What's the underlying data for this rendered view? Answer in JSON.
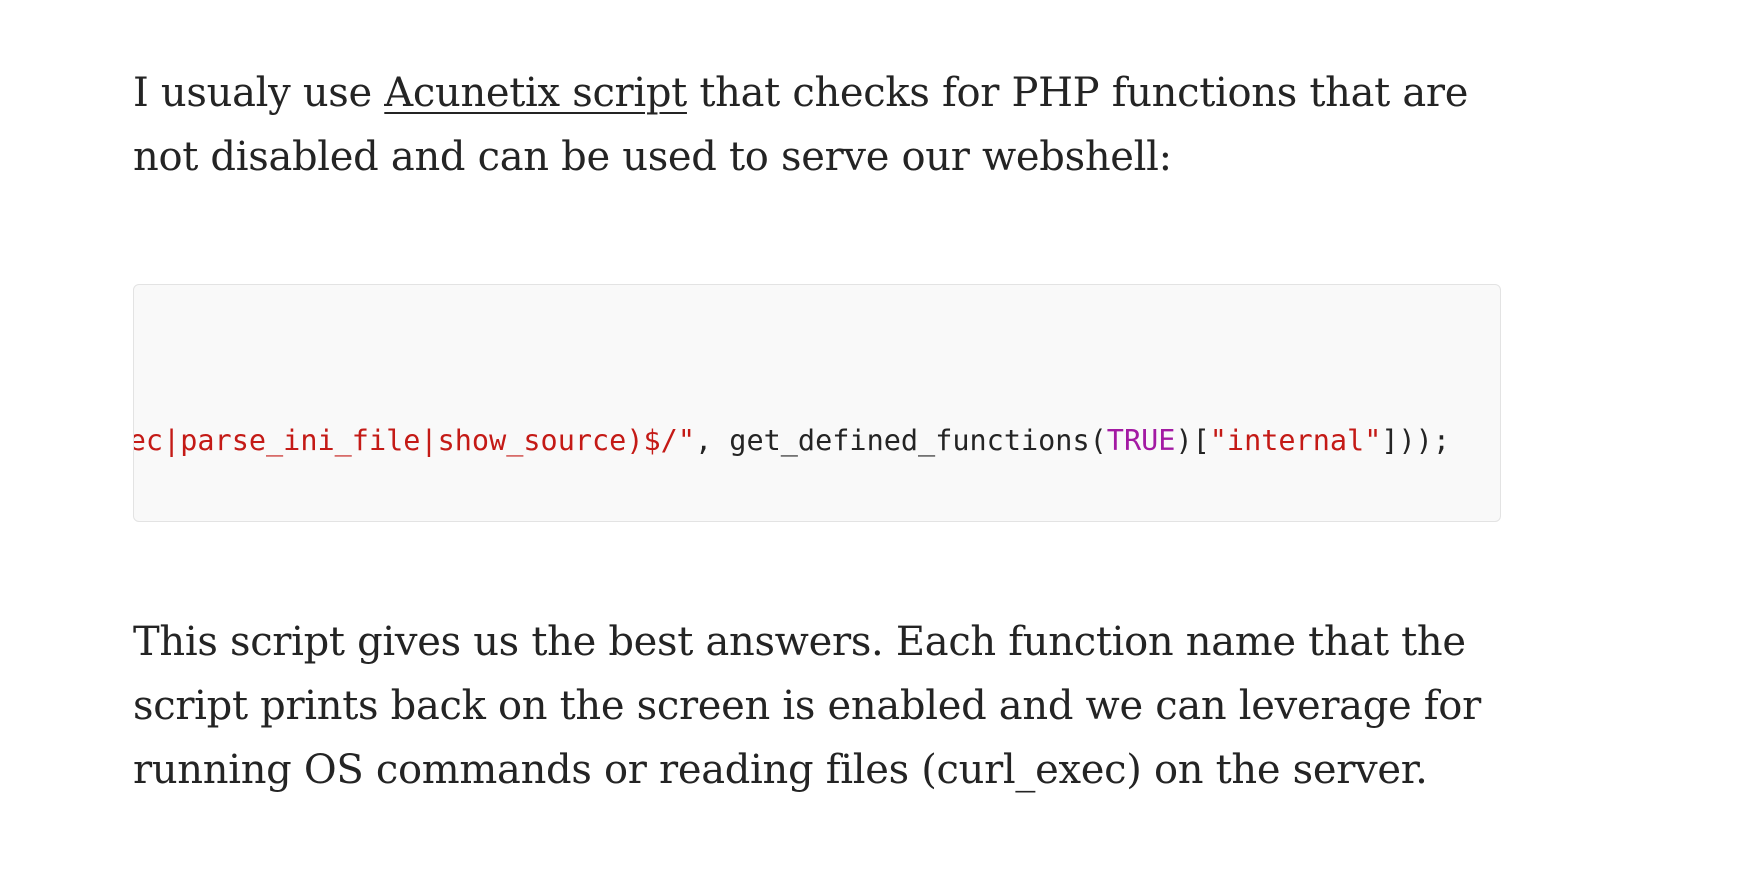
{
  "article": {
    "intro": {
      "before_link": "I usualy use ",
      "link_text": "Acunetix script",
      "after_link": " that checks for PHP functions that are not disabled and can be used to serve our webshell:"
    },
    "code": {
      "tokens": [
        {
          "kind": "str",
          "text": "i_exec|parse_ini_file|show_source)$/\""
        },
        {
          "kind": "plain",
          "text": ", get_defined_functions("
        },
        {
          "kind": "kw",
          "text": "TRUE"
        },
        {
          "kind": "plain",
          "text": ")["
        },
        {
          "kind": "str",
          "text": "\"internal\""
        },
        {
          "kind": "plain",
          "text": "]));"
        }
      ]
    },
    "outro": "This script gives us the best answers. Each function name that the script prints back on the screen is enabled and we can leverage for running OS commands or reading files (curl_exec) on the server."
  },
  "colors": {
    "text": "#242424",
    "code_background": "#f9f9f9",
    "code_border": "#e3e3e3",
    "string_token": "#c41a16",
    "keyword_token": "#a31aa3"
  }
}
